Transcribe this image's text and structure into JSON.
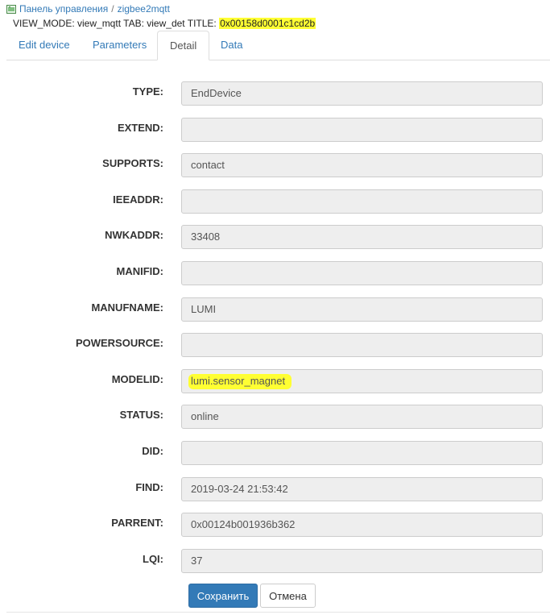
{
  "breadcrumb": {
    "home": "Панель управления",
    "separator": "/",
    "current": "zigbee2mqtt"
  },
  "meta": {
    "prefix": "VIEW_MODE: view_mqtt TAB: view_det TITLE:",
    "title": "0x00158d0001c1cd2b"
  },
  "tabs": [
    "Edit device",
    "Parameters",
    "Detail",
    "Data"
  ],
  "active_tab": "Detail",
  "fields": [
    {
      "label": "TYPE:",
      "value": "EndDevice"
    },
    {
      "label": "EXTEND:",
      "value": ""
    },
    {
      "label": "SUPPORTS:",
      "value": "contact"
    },
    {
      "label": "IEEADDR:",
      "value": ""
    },
    {
      "label": "NWKADDR:",
      "value": "33408"
    },
    {
      "label": "MANIFID:",
      "value": ""
    },
    {
      "label": "MANUFNAME:",
      "value": "LUMI"
    },
    {
      "label": "POWERSOURCE:",
      "value": ""
    },
    {
      "label": "MODELID:",
      "value": "lumi.sensor_magnet"
    },
    {
      "label": "STATUS:",
      "value": "online"
    },
    {
      "label": "DID:",
      "value": ""
    },
    {
      "label": "FIND:",
      "value": "2019-03-24 21:53:42"
    },
    {
      "label": "PARRENT:",
      "value": "0x00124b001936b362"
    },
    {
      "label": "LQI:",
      "value": "37"
    }
  ],
  "buttons": {
    "save": "Сохранить",
    "cancel": "Отмена"
  },
  "colors": {
    "link": "#337ab7",
    "highlight": "#ffff33",
    "primary": "#337ab7",
    "input_bg": "#eeeeee"
  }
}
